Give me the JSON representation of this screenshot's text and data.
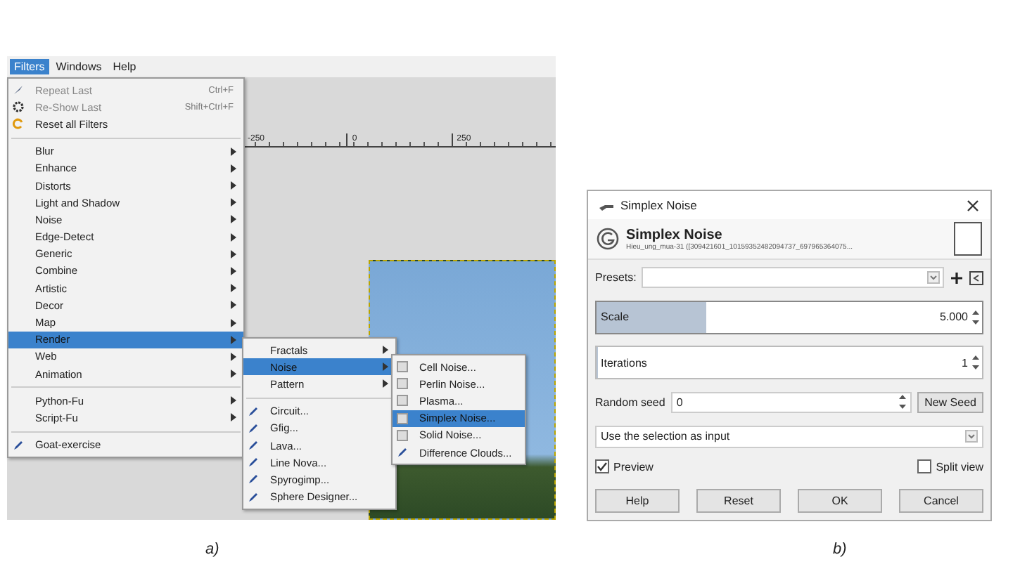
{
  "left_screenshot": {
    "menu_bar": [
      {
        "label": "Filters",
        "selected": true
      },
      {
        "label": "Windows",
        "selected": false
      },
      {
        "label": "Help",
        "selected": false
      }
    ],
    "ruler": [
      "-250",
      "0",
      "250"
    ],
    "filters_menu": {
      "sections": [
        {
          "items": [
            {
              "label": "Repeat Last",
              "shortcut": "Ctrl+F",
              "kind": "brush",
              "submenu": false,
              "selected": false,
              "disabled": true
            },
            {
              "label": "Re-Show Last",
              "shortcut": "Shift+Ctrl+F",
              "kind": "gear",
              "submenu": false,
              "selected": false,
              "disabled": true
            },
            {
              "label": "Reset all Filters",
              "kind": "reset",
              "submenu": false,
              "selected": false,
              "disabled": false
            }
          ]
        },
        {
          "items": [
            {
              "label": "Blur",
              "submenu": true,
              "selected": false,
              "disabled": false
            },
            {
              "label": "Enhance",
              "submenu": true,
              "selected": false,
              "disabled": false
            },
            {
              "label": "Distorts",
              "submenu": true,
              "selected": false,
              "disabled": false
            },
            {
              "label": "Light and Shadow",
              "submenu": true,
              "selected": false,
              "disabled": false
            },
            {
              "label": "Noise",
              "submenu": true,
              "selected": false,
              "disabled": false
            },
            {
              "label": "Edge-Detect",
              "submenu": true,
              "selected": false,
              "disabled": false
            },
            {
              "label": "Generic",
              "submenu": true,
              "selected": false,
              "disabled": false
            },
            {
              "label": "Combine",
              "submenu": true,
              "selected": false,
              "disabled": false
            },
            {
              "label": "Artistic",
              "submenu": true,
              "selected": false,
              "disabled": false
            },
            {
              "label": "Decor",
              "submenu": true,
              "selected": false,
              "disabled": false
            },
            {
              "label": "Map",
              "submenu": true,
              "selected": false,
              "disabled": false
            },
            {
              "label": "Render",
              "submenu": true,
              "selected": true,
              "disabled": false
            },
            {
              "label": "Web",
              "submenu": true,
              "selected": false,
              "disabled": false
            },
            {
              "label": "Animation",
              "submenu": true,
              "selected": false,
              "disabled": false
            }
          ]
        },
        {
          "items": [
            {
              "label": "Python-Fu",
              "submenu": true,
              "selected": false,
              "disabled": false
            },
            {
              "label": "Script-Fu",
              "submenu": true,
              "selected": false,
              "disabled": false
            }
          ]
        },
        {
          "items": [
            {
              "label": "Goat-exercise",
              "kind": "plugin",
              "submenu": false,
              "selected": false,
              "disabled": false
            }
          ]
        }
      ]
    },
    "render_menu": {
      "sections": [
        {
          "items": [
            {
              "label": "Fractals",
              "submenu": true,
              "selected": false
            },
            {
              "label": "Noise",
              "submenu": true,
              "selected": true
            },
            {
              "label": "Pattern",
              "submenu": true,
              "selected": false
            }
          ]
        },
        {
          "items": [
            {
              "label": "Circuit...",
              "kind": "plugin",
              "submenu": false,
              "selected": false
            },
            {
              "label": "Gfig...",
              "kind": "plugin",
              "submenu": false,
              "selected": false
            },
            {
              "label": "Lava...",
              "kind": "plugin",
              "submenu": false,
              "selected": false
            },
            {
              "label": "Line Nova...",
              "kind": "plugin",
              "submenu": false,
              "selected": false
            },
            {
              "label": "Spyrogimp...",
              "kind": "plugin",
              "submenu": false,
              "selected": false
            },
            {
              "label": "Sphere Designer...",
              "kind": "plugin",
              "submenu": false,
              "selected": false
            }
          ]
        }
      ]
    },
    "noise_menu": {
      "sections": [
        {
          "items": [
            {
              "label": "Cell Noise...",
              "kind": "gegl",
              "submenu": false,
              "selected": false
            },
            {
              "label": "Perlin Noise...",
              "kind": "gegl",
              "submenu": false,
              "selected": false
            },
            {
              "label": "Plasma...",
              "kind": "gegl",
              "submenu": false,
              "selected": false
            },
            {
              "label": "Simplex Noise...",
              "kind": "gegl",
              "submenu": false,
              "selected": true
            },
            {
              "label": "Solid Noise...",
              "kind": "gegl",
              "submenu": false,
              "selected": false
            },
            {
              "label": "Difference Clouds...",
              "kind": "plugin",
              "submenu": false,
              "selected": false
            }
          ]
        }
      ]
    }
  },
  "dialog": {
    "title": "Simplex Noise",
    "heading": "Simplex Noise",
    "subtitle": "Hieu_ung_mua-31 ([309421601_10159352482094737_697965364075...",
    "presets_label": "Presets:",
    "sliders": [
      {
        "label": "Scale",
        "value": "5.000",
        "level": 0.28
      },
      {
        "label": "Iterations",
        "value": "1",
        "level": 0.0
      }
    ],
    "seed_label": "Random seed",
    "seed_value": "0",
    "new_seed_button": "New Seed",
    "input_select": "Use the selection as input",
    "preview": {
      "label": "Preview",
      "checked": true
    },
    "split_view": {
      "label": "Split view",
      "checked": false
    },
    "buttons": [
      "Help",
      "Reset",
      "OK",
      "Cancel"
    ]
  },
  "captions": [
    "a)",
    "b)"
  ]
}
